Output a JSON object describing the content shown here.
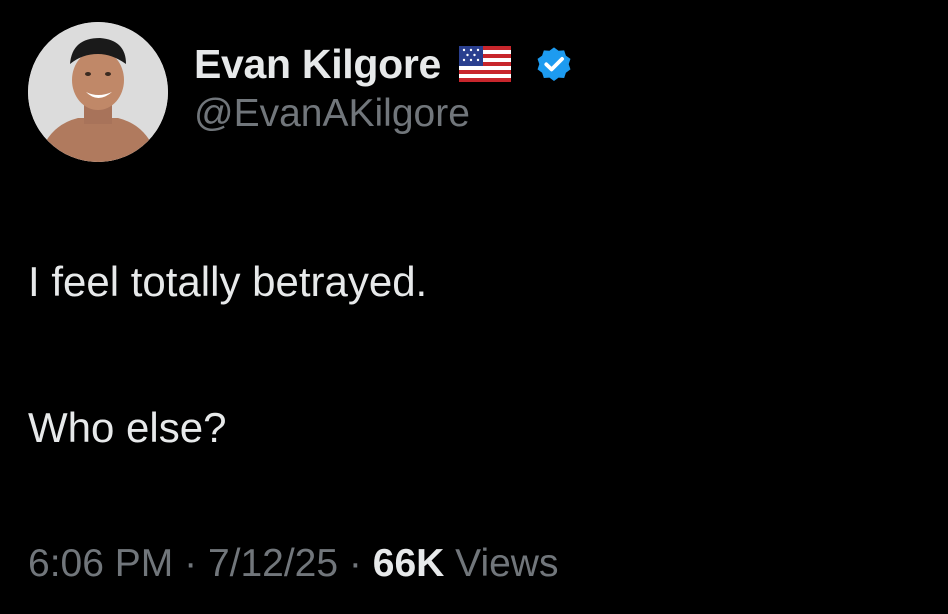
{
  "author": {
    "display_name": "Evan Kilgore",
    "handle": "@EvanAKilgore",
    "flag_icon": "us-flag-icon",
    "verified_icon": "verified-badge-icon",
    "verified_color": "#1d9bf0"
  },
  "tweet": {
    "line1": "I feel totally betrayed.",
    "line2": "Who else?"
  },
  "meta": {
    "time": "6:06 PM",
    "separator": "·",
    "date": "7/12/25",
    "views_count": "66K",
    "views_label": "Views"
  },
  "colors": {
    "background": "#000000",
    "primary_text": "#e7e9ea",
    "secondary_text": "#71767b"
  }
}
